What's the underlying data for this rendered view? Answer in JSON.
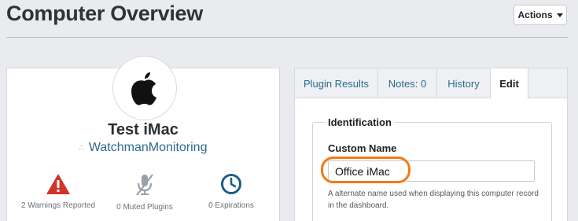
{
  "header": {
    "title": "Computer Overview",
    "actions_label": "Actions"
  },
  "summary": {
    "computer_name": "Test iMac",
    "organization": "WatchmanMonitoring",
    "stats": [
      {
        "label": "2 Warnings Reported",
        "icon": "warning-icon",
        "color": "#d0342c"
      },
      {
        "label": "0 Muted Plugins",
        "icon": "muted-microphone-icon",
        "color": "#9aa0a6"
      },
      {
        "label": "0 Expirations",
        "icon": "clock-icon",
        "color": "#1f5f86"
      }
    ]
  },
  "tabs": [
    {
      "label": "Plugin Results",
      "active": false
    },
    {
      "label": "Notes: 0",
      "active": false
    },
    {
      "label": "History",
      "active": false
    },
    {
      "label": "Edit",
      "active": true
    }
  ],
  "edit": {
    "section_title": "Identification",
    "custom_name_label": "Custom Name",
    "custom_name_value": "Office iMac",
    "help_text": "A alternate name used when displaying this computer record in the dashboard."
  },
  "colors": {
    "link": "#2c6b8e",
    "highlight": "#f07a1a"
  }
}
